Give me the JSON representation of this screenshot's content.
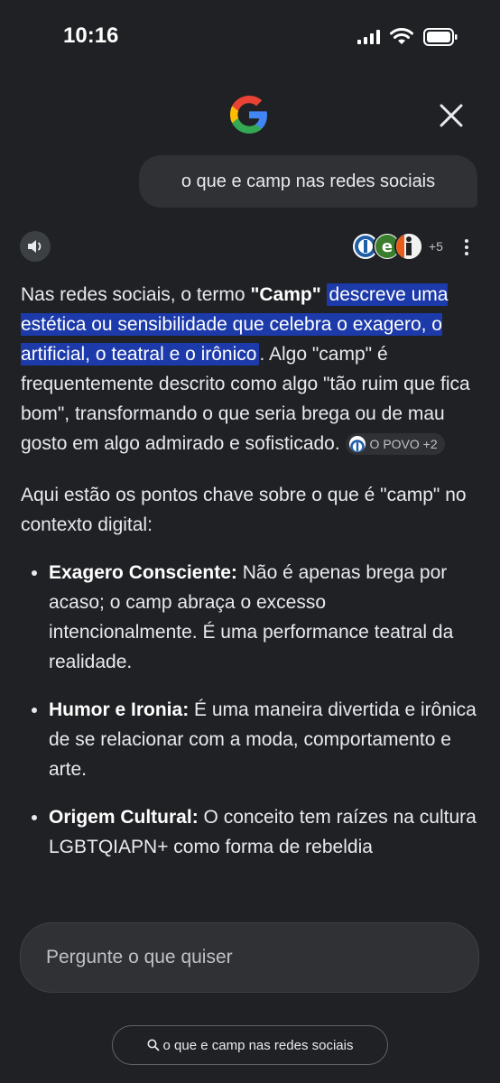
{
  "status": {
    "time": "10:16"
  },
  "query": {
    "text": "o que e camp nas redes sociais"
  },
  "sources": {
    "more_count": "+5"
  },
  "answer": {
    "p1_a": "Nas redes sociais, o termo ",
    "p1_term": "\"Camp\"",
    "p1_highlight": "descreve uma estética ou sensibilidade que celebra o exagero, o artificial, o teatral e o irônico",
    "p1_b": ". Algo \"camp\" é frequentemente descrito como algo \"tão ruim que fica bom\", transformando o que seria brega ou de mau gosto em algo admirado e sofisticado. ",
    "citation": "O POVO +2",
    "p2": "Aqui estão os pontos chave sobre o que é \"camp\" no contexto digital:",
    "bullets": [
      {
        "title": "Exagero Consciente:",
        "text": " Não é apenas brega por acaso; o camp abraça o excesso intencionalmente. É uma performance teatral da realidade."
      },
      {
        "title": "Humor e Ironia:",
        "text": " É uma maneira divertida e irônica de se relacionar com a moda, comportamento e arte."
      },
      {
        "title": "Origem Cultural:",
        "text": " O conceito tem raízes na cultura LGBTQIAPN+ como forma de rebeldia"
      }
    ]
  },
  "ask": {
    "placeholder": "Pergunte o que quiser"
  },
  "recent_query": {
    "label": "o que e camp nas redes sociais"
  },
  "colors": {
    "background": "#202124",
    "highlight": "#1c3aa9",
    "bubble": "#303134"
  }
}
